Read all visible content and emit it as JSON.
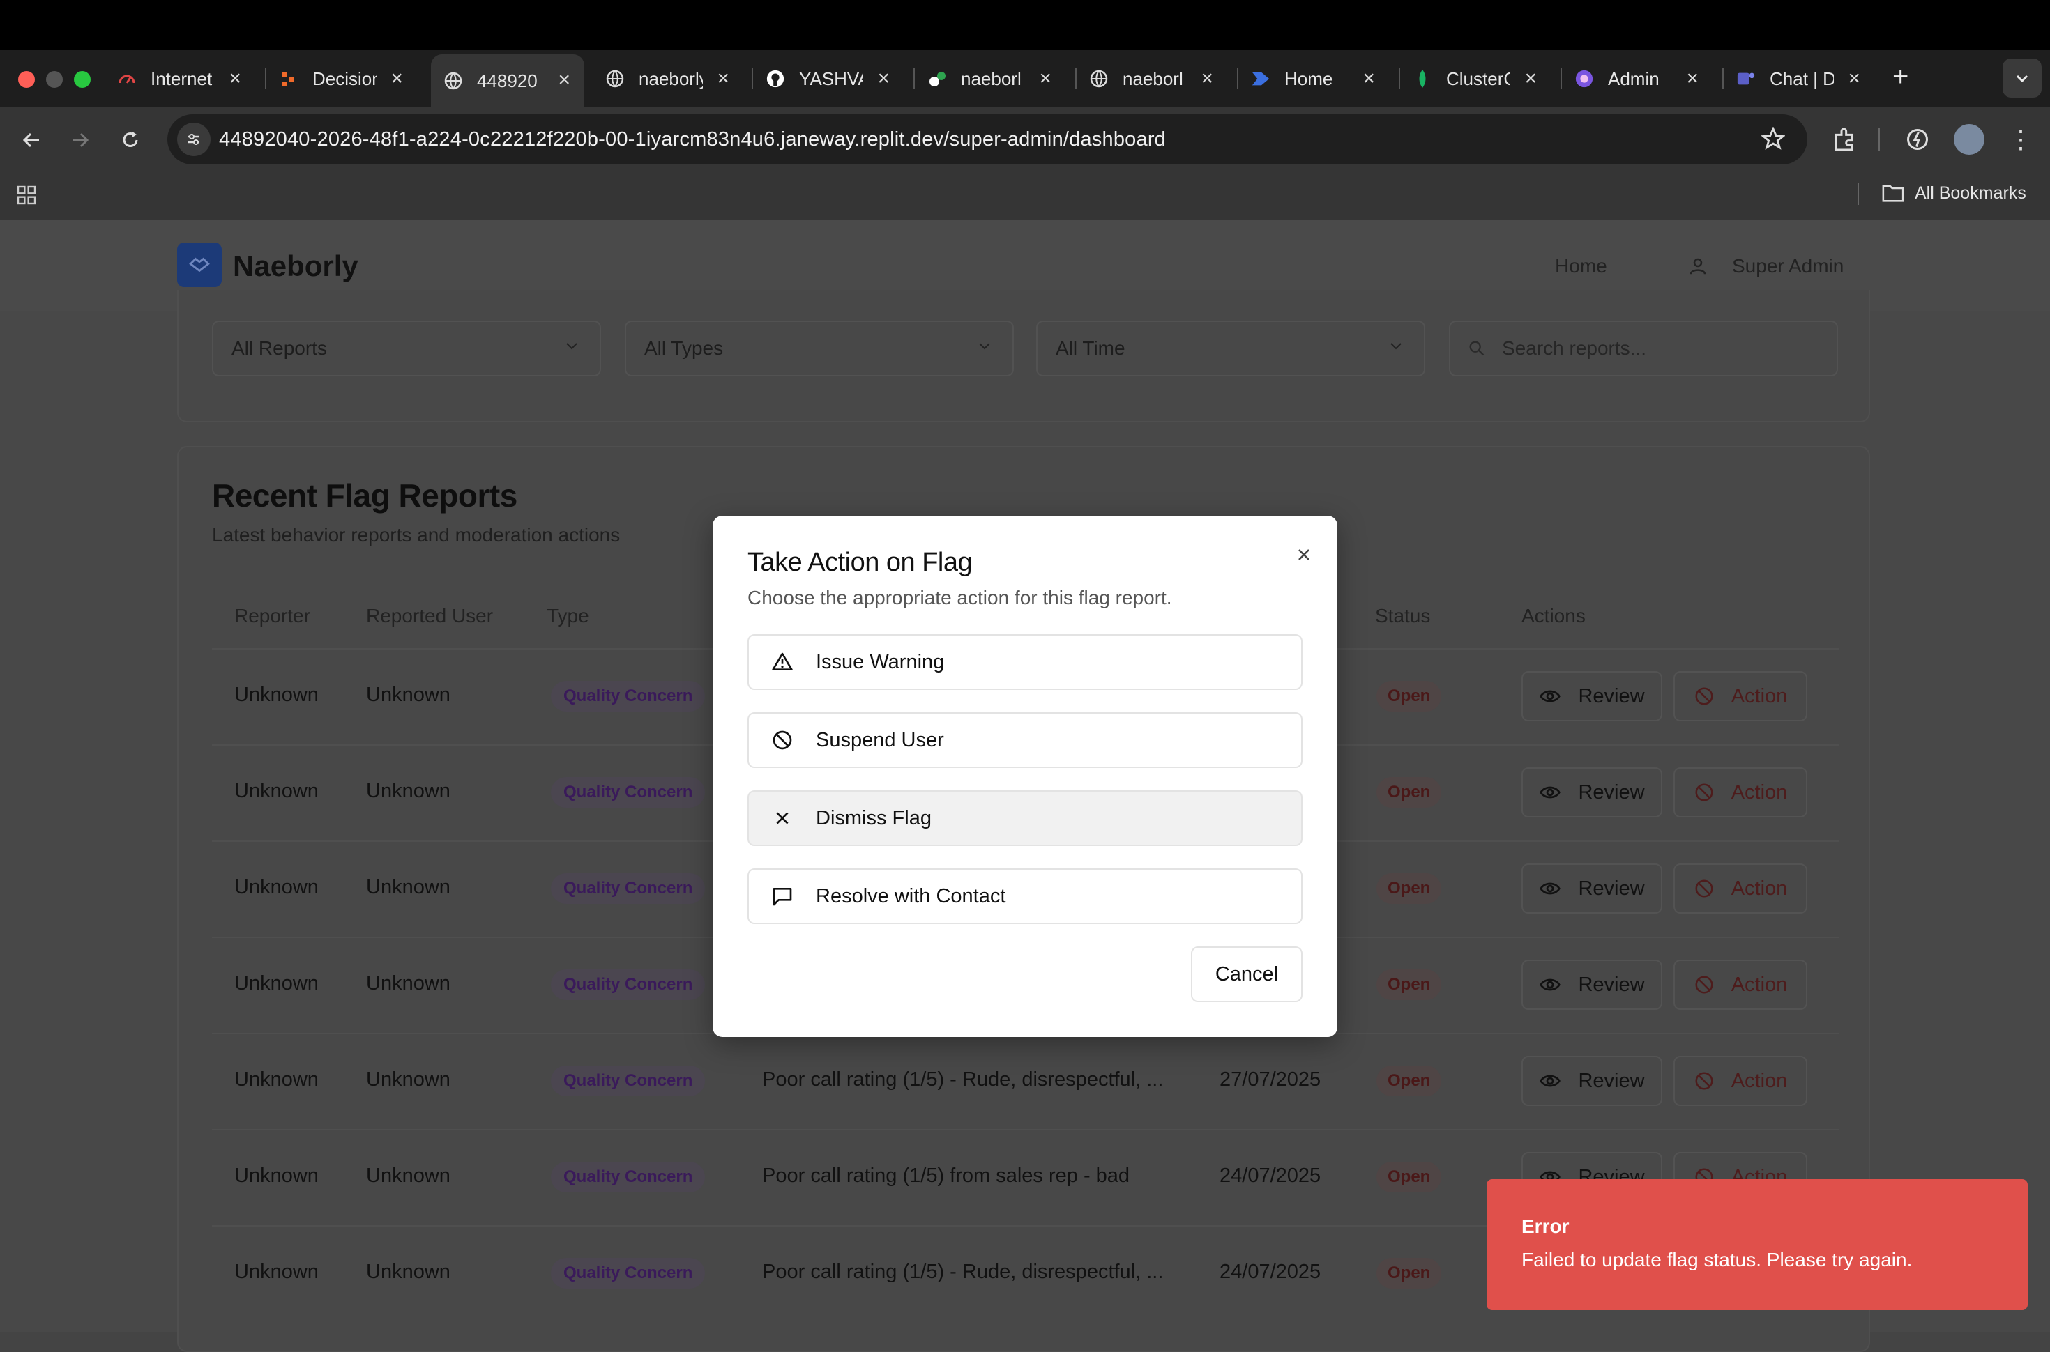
{
  "browser": {
    "tabs": [
      {
        "title": "Internet",
        "icon": "gauge-icon"
      },
      {
        "title": "Decision",
        "icon": "decision-icon"
      },
      {
        "title": "448920",
        "icon": "globe-icon"
      },
      {
        "title": "naeborly",
        "icon": "globe-icon"
      },
      {
        "title": "YASHVA",
        "icon": "github-icon"
      },
      {
        "title": "naeborl",
        "icon": "replit-icon"
      },
      {
        "title": "naeborl",
        "icon": "globe-icon"
      },
      {
        "title": "Home",
        "icon": "home-app-icon"
      },
      {
        "title": "ClusterC",
        "icon": "leaf-icon"
      },
      {
        "title": "Admin",
        "icon": "admin-icon"
      },
      {
        "title": "Chat | D",
        "icon": "teams-icon"
      }
    ],
    "url": "44892040-2026-48f1-a224-0c22212f220b-00-1iyarcm83n4u6.janeway.replit.dev/super-admin/dashboard",
    "bookmarks_label": "All Bookmarks"
  },
  "app": {
    "brand": "Naeborly",
    "nav_home": "Home",
    "nav_user": "Super Admin"
  },
  "filters": {
    "reports": "All Reports",
    "types": "All Types",
    "time": "All Time",
    "search_placeholder": "Search reports..."
  },
  "section": {
    "title": "Recent Flag Reports",
    "subtitle": "Latest behavior reports and moderation actions"
  },
  "table": {
    "headers": [
      "Reporter",
      "Reported User",
      "Type",
      "Status",
      "Actions"
    ],
    "review_label": "Review",
    "action_label": "Action",
    "rows": [
      {
        "reporter": "Unknown",
        "reported": "Unknown",
        "type": "Quality Concern",
        "desc": "",
        "date": "",
        "status": "Open"
      },
      {
        "reporter": "Unknown",
        "reported": "Unknown",
        "type": "Quality Concern",
        "desc": "",
        "date": "",
        "status": "Open"
      },
      {
        "reporter": "Unknown",
        "reported": "Unknown",
        "type": "Quality Concern",
        "desc": "",
        "date": "",
        "status": "Open"
      },
      {
        "reporter": "Unknown",
        "reported": "Unknown",
        "type": "Quality Concern",
        "desc": "",
        "date": "",
        "status": "Open"
      },
      {
        "reporter": "Unknown",
        "reported": "Unknown",
        "type": "Quality Concern",
        "desc": "Poor call rating (1/5) - Rude, disrespectful, ...",
        "date": "27/07/2025",
        "status": "Open"
      },
      {
        "reporter": "Unknown",
        "reported": "Unknown",
        "type": "Quality Concern",
        "desc": "Poor call rating (1/5) from sales rep - bad",
        "date": "24/07/2025",
        "status": "Open"
      },
      {
        "reporter": "Unknown",
        "reported": "Unknown",
        "type": "Quality Concern",
        "desc": "Poor call rating (1/5) - Rude, disrespectful, ...",
        "date": "24/07/2025",
        "status": "Open"
      }
    ]
  },
  "modal": {
    "title": "Take Action on Flag",
    "subtitle": "Choose the appropriate action for this flag report.",
    "options": [
      {
        "label": "Issue Warning",
        "icon": "warning-triangle-icon"
      },
      {
        "label": "Suspend User",
        "icon": "ban-icon"
      },
      {
        "label": "Dismiss Flag",
        "icon": "x-icon"
      },
      {
        "label": "Resolve with Contact",
        "icon": "message-icon"
      }
    ],
    "cancel_label": "Cancel"
  },
  "toast": {
    "title": "Error",
    "message": "Failed to update flag status. Please try again.",
    "color": "#e0504b"
  }
}
